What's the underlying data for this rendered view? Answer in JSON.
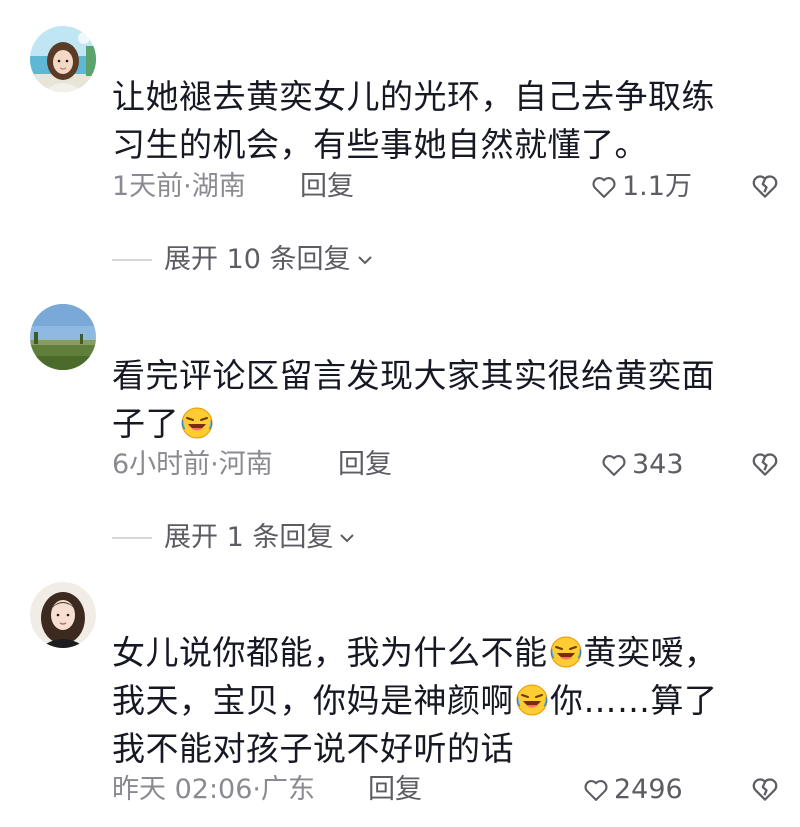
{
  "comments": [
    {
      "text_lines": [
        "让她褪去黄奕女儿的光环，自己去争取练",
        "习生的机会，有些事她自然就懂了。"
      ],
      "meta_time": "1天前·湖南",
      "reply_label": "回复",
      "like_count": "1.1万",
      "expand_label": "展开 10 条回复",
      "avatar_icon": "avatar-girl-sea-icon"
    },
    {
      "text_lines": [
        "看完评论区留言发现大家其实很给黄奕面",
        "子了"
      ],
      "meta_time": "6小时前·河南",
      "reply_label": "回复",
      "like_count": "343",
      "expand_label": "展开 1 条回复",
      "avatar_icon": "avatar-landscape-icon"
    },
    {
      "text_lines": [
        "女儿说你都能，我为什么不能",
        "黄奕嗳，",
        "我天，宝贝，你妈是神颜啊",
        "你……算了",
        "我不能对孩子说不好听的话"
      ],
      "meta_time": "昨天 02:06·广东",
      "reply_label": "回复",
      "like_count": "2496",
      "avatar_icon": "avatar-woman-icon"
    }
  ],
  "icons": {
    "like": "heart-outline-icon",
    "dislike": "broken-heart-icon",
    "emoji": "laugh-cry-emoji-icon",
    "expand": "chevron-down-icon"
  },
  "colors": {
    "text": "#161823",
    "meta": "#8a8b91",
    "action": "#5c5d63"
  }
}
